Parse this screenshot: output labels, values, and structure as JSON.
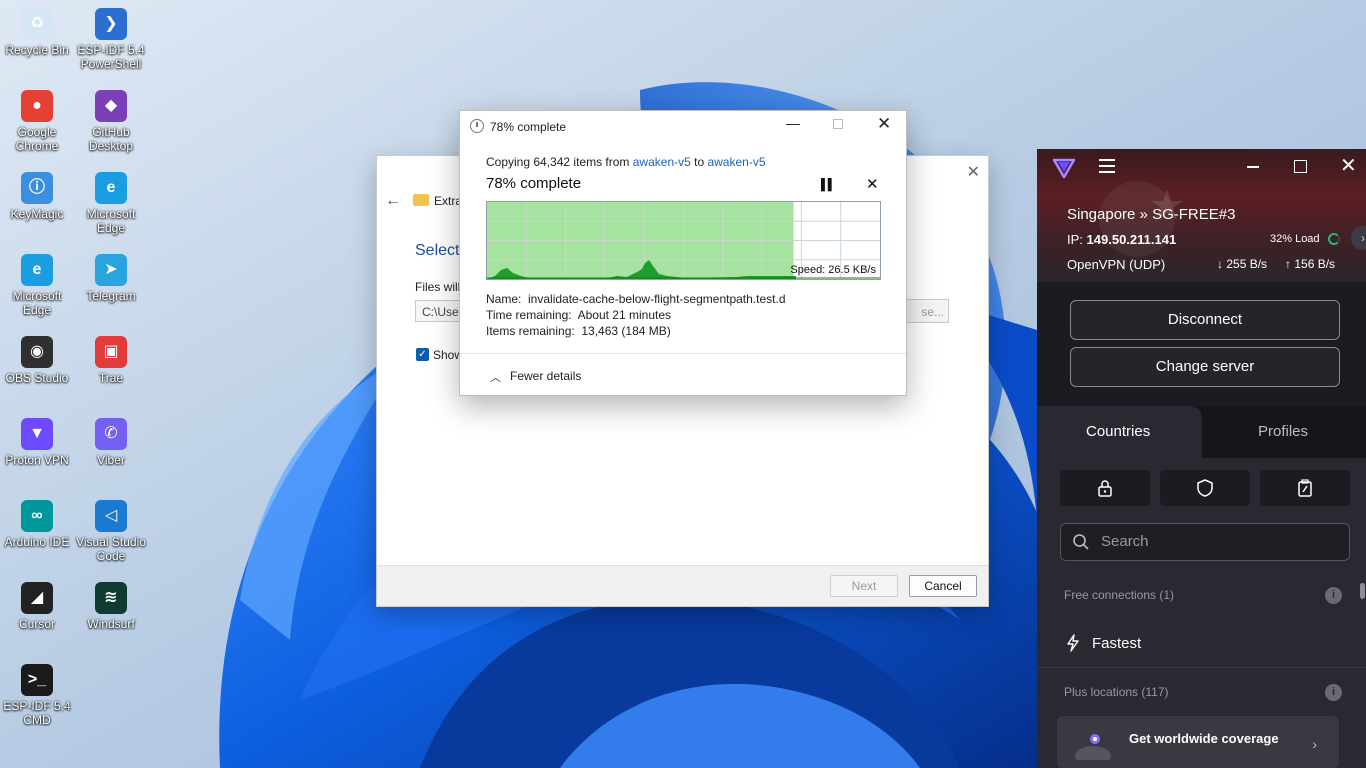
{
  "desktop": {
    "icons": [
      {
        "label": "Recycle Bin",
        "icon": "recycle-bin-icon",
        "color": "#d7e6f4"
      },
      {
        "label": "ESP-IDF 5.4 PowerShell",
        "icon": "powershell-icon",
        "color": "#2a6fd1"
      },
      {
        "label": "Google Chrome",
        "icon": "chrome-icon",
        "color": "#e44134"
      },
      {
        "label": "GitHub Desktop",
        "icon": "github-desktop-icon",
        "color": "#7b3fb8"
      },
      {
        "label": "KeyMagic",
        "icon": "keymagic-icon",
        "color": "#3a8fe0"
      },
      {
        "label": "Microsoft Edge",
        "icon": "edge-icon",
        "color": "#1b9de2"
      },
      {
        "label": "Microsoft Edge",
        "icon": "edge-icon",
        "color": "#1b9de2"
      },
      {
        "label": "Telegram",
        "icon": "telegram-icon",
        "color": "#2aa3df"
      },
      {
        "label": "OBS Studio",
        "icon": "obs-icon",
        "color": "#303030"
      },
      {
        "label": "Trae",
        "icon": "trae-icon",
        "color": "#e23b3b"
      },
      {
        "label": "Proton VPN",
        "icon": "proton-vpn-icon",
        "color": "#6d4aff"
      },
      {
        "label": "Viber",
        "icon": "viber-icon",
        "color": "#7360f2"
      },
      {
        "label": "Arduino IDE",
        "icon": "arduino-icon",
        "color": "#00979c"
      },
      {
        "label": "Visual Studio Code",
        "icon": "vscode-icon",
        "color": "#1a7ad1"
      },
      {
        "label": "Cursor",
        "icon": "cursor-icon",
        "color": "#222222"
      },
      {
        "label": "Windsurf",
        "icon": "windsurf-icon",
        "color": "#0f3b33"
      },
      {
        "label": "ESP-IDF 5.4 CMD",
        "icon": "cmd-icon",
        "color": "#1a1a1a"
      }
    ]
  },
  "wizard": {
    "title": "Extra",
    "heading": "Select",
    "files_label": "Files will",
    "path_value": "C:\\User",
    "browse_label": "se...",
    "checkbox_label": "Show",
    "next_label": "Next",
    "cancel_label": "Cancel"
  },
  "copy_dialog": {
    "title": "78% complete",
    "copying_prefix": "Copying 64,342 items from ",
    "source": "awaken-v5",
    "to_word": " to ",
    "destination": "awaken-v5",
    "percent_label": "78% complete",
    "progress": 0.78,
    "speed": "Speed: 26.5 KB/s",
    "name_label": "Name:",
    "name_value": "invalidate-cache-below-flight-segmentpath.test.d",
    "time_label": "Time remaining:",
    "time_value": "About 21 minutes",
    "items_label": "Items remaining:",
    "items_value": "13,463 (184 MB)",
    "fewer_details": "Fewer details",
    "colors": {
      "fill": "#a6e3a1",
      "curve": "#1f9e2b",
      "link": "#1a64b4"
    }
  },
  "vpn": {
    "server": "Singapore » SG-FREE#3",
    "ip_label": "IP:",
    "ip_value": "149.50.211.141",
    "load": "32% Load",
    "protocol": "OpenVPN (UDP)",
    "download": "255 B/s",
    "upload": "156 B/s",
    "disconnect_label": "Disconnect",
    "change_server_label": "Change server",
    "tabs": [
      "Countries",
      "Profiles"
    ],
    "search_placeholder": "Search",
    "free_section": "Free connections (1)",
    "fastest_label": "Fastest",
    "plus_section": "Plus locations (117)",
    "promo_text": "Get worldwide coverage",
    "colors": {
      "accent": "#6d4aff",
      "load_ring": "#2bb673"
    }
  }
}
